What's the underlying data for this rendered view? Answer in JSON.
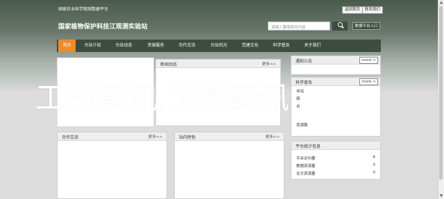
{
  "header": {
    "top_text": "国家农业科学观测数据平台",
    "top_links": [
      "返回首页",
      "联系我们"
    ],
    "site_title": "国家植物保护科技江观测实验站",
    "search": {
      "placeholder": "请输入要搜索的内容"
    },
    "secondary_button": "数据平台入口"
  },
  "nav": {
    "items": [
      "首页",
      "台站介绍",
      "台站动态",
      "资源服务",
      "合作交流",
      "台站风光",
      "党建文化",
      "科学普及",
      "关于我们"
    ],
    "active_index": 0
  },
  "panels": {
    "news": {
      "title": "新闻动态",
      "more": "更多>>"
    },
    "cooperation": {
      "title": "合作交流",
      "more": "更多>>"
    },
    "scenery": {
      "title": "站内特色",
      "more": "更多>>"
    },
    "notice": {
      "title": "通知公告",
      "more": "more >"
    },
    "science": {
      "title": "科学普及",
      "more": "more >",
      "partial_lines": [
        "台站",
        "简",
        "台",
        "资源服"
      ]
    },
    "stats": {
      "title": "平台统计信息",
      "rows": [
        {
          "label": "平台访问量",
          "value": "6"
        },
        {
          "label": "数据资源量",
          "value": "0"
        },
        {
          "label": "论文资源量",
          "value": "0"
        }
      ]
    }
  },
  "overlay": {
    "watermark": "工控资讯,工控资讯"
  },
  "colors": {
    "nav_bg": "#3c4c3e",
    "nav_active": "#f08a2a",
    "header_top": "#4a5a4a"
  }
}
